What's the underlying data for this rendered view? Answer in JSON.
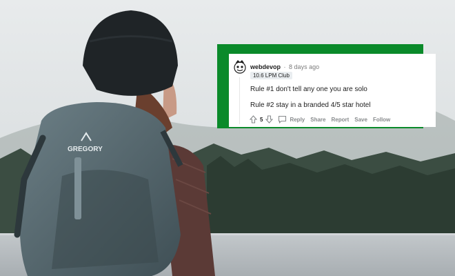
{
  "photo": {
    "subject": "hiker with backpack looking at misty forest lake",
    "backpack_brand": "GREGORY",
    "colors": {
      "sky": "#dfe3e5",
      "forest": "#324338",
      "water": "#b9bec2",
      "backpack": "#52646b",
      "beanie": "#1f2427"
    }
  },
  "comment": {
    "frame_color": "#0a8a2a",
    "username": "webdevop",
    "separator": "·",
    "timestamp": "8 days ago",
    "flair": "10.6 LPM Club",
    "lines": [
      "Rule #1 don't tell any one you are solo",
      "Rule #2 stay in a branded 4/5 star hotel"
    ],
    "actions": {
      "upvote_icon": "upvote-arrow-icon",
      "vote_count": "5",
      "downvote_icon": "downvote-arrow-icon",
      "reply_icon": "comment-bubble-icon",
      "reply": "Reply",
      "share": "Share",
      "report": "Report",
      "save": "Save",
      "follow": "Follow"
    }
  }
}
